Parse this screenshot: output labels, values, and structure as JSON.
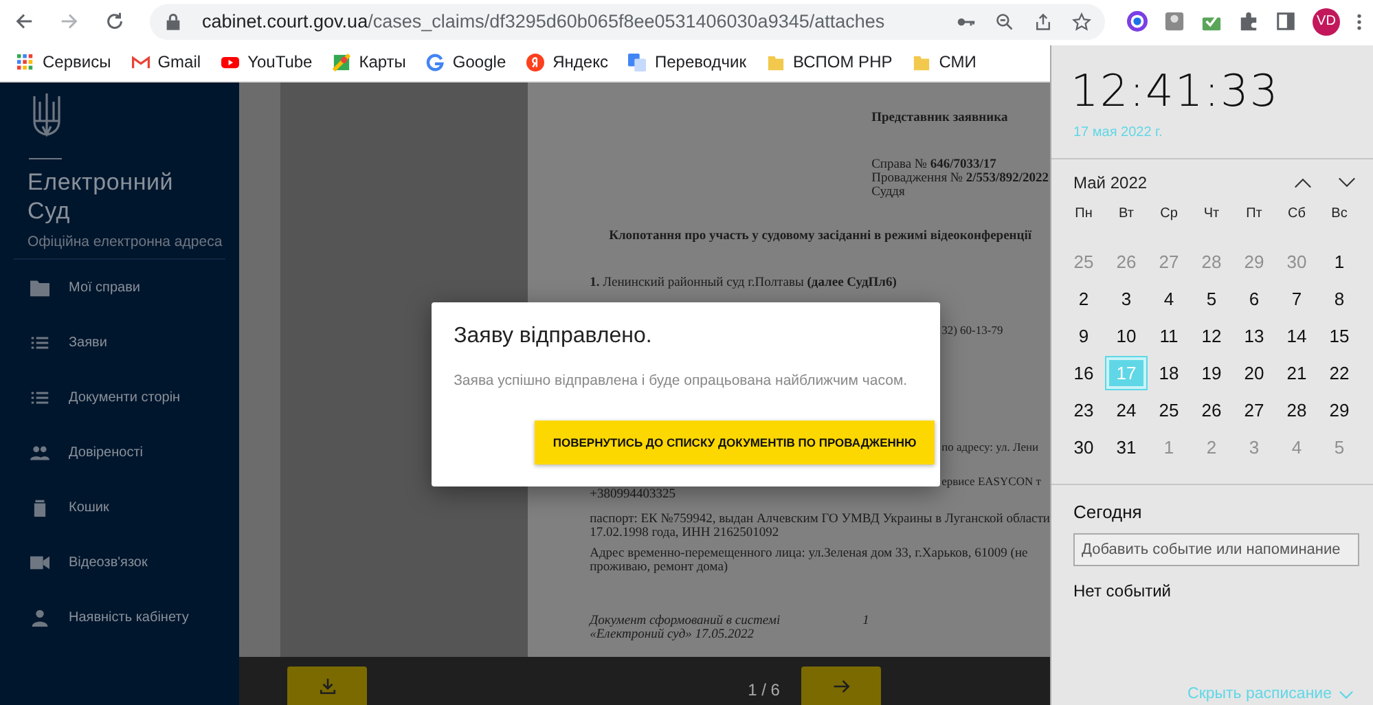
{
  "browser": {
    "url_host": "cabinet.court.gov.ua",
    "url_path": "/cases_claims/df3295d60b065f8ee0531406030a9345/attaches",
    "avatar": "VD"
  },
  "bookmarks": [
    {
      "kind": "apps",
      "label": "Сервисы"
    },
    {
      "kind": "gmail",
      "label": "Gmail"
    },
    {
      "kind": "youtube",
      "label": "YouTube"
    },
    {
      "kind": "maps",
      "label": "Карты"
    },
    {
      "kind": "google",
      "label": "Google"
    },
    {
      "kind": "yandex",
      "label": "Яндекс"
    },
    {
      "kind": "translate",
      "label": "Переводчик"
    },
    {
      "kind": "folder",
      "label": "ВСПОМ PHP"
    },
    {
      "kind": "folder",
      "label": "СМИ"
    }
  ],
  "sidebar": {
    "title": "Електронний Суд",
    "subtitle": "Офіційна електронна адреса",
    "items": [
      {
        "kind": "folder",
        "label": "Мої справи"
      },
      {
        "kind": "list",
        "label": "Заяви"
      },
      {
        "kind": "list",
        "label": "Документи сторін"
      },
      {
        "kind": "people",
        "label": "Довіреності"
      },
      {
        "kind": "trash",
        "label": "Кошик"
      },
      {
        "kind": "video",
        "label": "Відеозв'язок"
      },
      {
        "kind": "person",
        "label": "Наявність кабінету"
      }
    ]
  },
  "document": {
    "blocks": [
      {
        "kind": "signature",
        "lines": [
          "Представник заявника"
        ]
      },
      {
        "kind": "case",
        "lines": [
          "Справа № **646/7033/17**",
          "Провадження № **2/553/892/2022**",
          "Суддя"
        ]
      },
      {
        "kind": "title",
        "lines": [
          "Клопотання про участь у судовому засіданні в режимі відеоконференції"
        ]
      },
      {
        "kind": "para",
        "lines": [
          "**1.** Ленинский районный суд г.Полтавы **(далее СудПл6)**"
        ]
      },
      {
        "kind": "fragment",
        "lines": [
          "32) 60-13-79"
        ]
      },
      {
        "kind": "fragment",
        "lines": [
          "по адресу: ул. Лени"
        ]
      },
      {
        "kind": "fragment",
        "lines": [
          "ервисе EASYCON т"
        ]
      },
      {
        "kind": "para",
        "lines": [
          "+380994403325"
        ]
      },
      {
        "kind": "para",
        "lines": [
          "паспорт: ЕК №759942, выдан Алчевским ГО УМВД Украины в Луганской области",
          "17.02.1998 года, ИНН 2162501092"
        ]
      },
      {
        "kind": "para",
        "lines": [
          "Адрес временно-перемещенного лица: ул.Зеленая дом 33, г.Харьков, 61009 (не",
          "проживаю, ремонт дома)"
        ]
      },
      {
        "kind": "footer",
        "lines": [
          "Документ сформований в системі",
          "«Електроний суд» 17.05.2022"
        ],
        "page_mark": "1"
      }
    ],
    "pager": "1 / 6"
  },
  "modal": {
    "title": "Заяву відправлено.",
    "message": "Заява успішно відправлена і буде опрацьована найближчим часом.",
    "button": "ПОВЕРНУТИСЬ ДО СПИСКУ ДОКУМЕНТІВ ПО ПРОВАДЖЕННЮ"
  },
  "calendar": {
    "time": "12:41:33",
    "date": "17 мая 2022 г.",
    "month": "Май 2022",
    "weekdays": [
      "Пн",
      "Вт",
      "Ср",
      "Чт",
      "Пт",
      "Сб",
      "Вс"
    ],
    "days": [
      {
        "label": "25",
        "in_month": false,
        "selected": false
      },
      {
        "label": "26",
        "in_month": false,
        "selected": false
      },
      {
        "label": "27",
        "in_month": false,
        "selected": false
      },
      {
        "label": "28",
        "in_month": false,
        "selected": false
      },
      {
        "label": "29",
        "in_month": false,
        "selected": false
      },
      {
        "label": "30",
        "in_month": false,
        "selected": false
      },
      {
        "label": "1",
        "in_month": true,
        "selected": false
      },
      {
        "label": "2",
        "in_month": true,
        "selected": false
      },
      {
        "label": "3",
        "in_month": true,
        "selected": false
      },
      {
        "label": "4",
        "in_month": true,
        "selected": false
      },
      {
        "label": "5",
        "in_month": true,
        "selected": false
      },
      {
        "label": "6",
        "in_month": true,
        "selected": false
      },
      {
        "label": "7",
        "in_month": true,
        "selected": false
      },
      {
        "label": "8",
        "in_month": true,
        "selected": false
      },
      {
        "label": "9",
        "in_month": true,
        "selected": false
      },
      {
        "label": "10",
        "in_month": true,
        "selected": false
      },
      {
        "label": "11",
        "in_month": true,
        "selected": false
      },
      {
        "label": "12",
        "in_month": true,
        "selected": false
      },
      {
        "label": "13",
        "in_month": true,
        "selected": false
      },
      {
        "label": "14",
        "in_month": true,
        "selected": false
      },
      {
        "label": "15",
        "in_month": true,
        "selected": false
      },
      {
        "label": "16",
        "in_month": true,
        "selected": false
      },
      {
        "label": "17",
        "in_month": true,
        "selected": true
      },
      {
        "label": "18",
        "in_month": true,
        "selected": false
      },
      {
        "label": "19",
        "in_month": true,
        "selected": false
      },
      {
        "label": "20",
        "in_month": true,
        "selected": false
      },
      {
        "label": "21",
        "in_month": true,
        "selected": false
      },
      {
        "label": "22",
        "in_month": true,
        "selected": false
      },
      {
        "label": "23",
        "in_month": true,
        "selected": false
      },
      {
        "label": "24",
        "in_month": true,
        "selected": false
      },
      {
        "label": "25",
        "in_month": true,
        "selected": false
      },
      {
        "label": "26",
        "in_month": true,
        "selected": false
      },
      {
        "label": "27",
        "in_month": true,
        "selected": false
      },
      {
        "label": "28",
        "in_month": true,
        "selected": false
      },
      {
        "label": "29",
        "in_month": true,
        "selected": false
      },
      {
        "label": "30",
        "in_month": true,
        "selected": false
      },
      {
        "label": "31",
        "in_month": true,
        "selected": false
      },
      {
        "label": "1",
        "in_month": false,
        "selected": false
      },
      {
        "label": "2",
        "in_month": false,
        "selected": false
      },
      {
        "label": "3",
        "in_month": false,
        "selected": false
      },
      {
        "label": "4",
        "in_month": false,
        "selected": false
      },
      {
        "label": "5",
        "in_month": false,
        "selected": false
      }
    ],
    "today_heading": "Сегодня",
    "event_placeholder": "Добавить событие или напоминание",
    "no_events": "Нет событий",
    "hide_link": "Скрыть расписание"
  }
}
